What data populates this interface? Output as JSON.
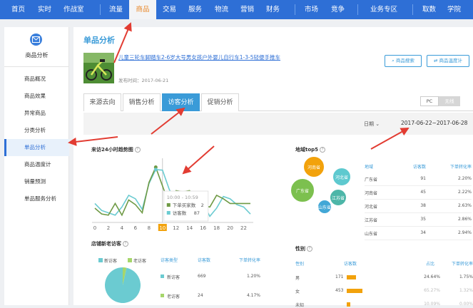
{
  "nav": {
    "items": [
      {
        "label": "首页"
      },
      {
        "label": "实时"
      },
      {
        "label": "作战室"
      },
      {
        "label": "流量"
      },
      {
        "label": "商品"
      },
      {
        "label": "交易"
      },
      {
        "label": "服务"
      },
      {
        "label": "物流"
      },
      {
        "label": "营销"
      },
      {
        "label": "财务"
      },
      {
        "label": "市场"
      },
      {
        "label": "竞争"
      },
      {
        "label": "业务专区"
      },
      {
        "label": "取数"
      },
      {
        "label": "学院"
      }
    ],
    "active_index": 4
  },
  "sidebar": {
    "title": "商品分析",
    "icon": "envelope-icon",
    "items": [
      {
        "label": "商品概况"
      },
      {
        "label": "商品效果"
      },
      {
        "label": "异常商品"
      },
      {
        "label": "分类分析"
      },
      {
        "label": "单品分析"
      },
      {
        "label": "商品温度计"
      },
      {
        "label": "销量预测"
      },
      {
        "label": "单品服务分析"
      }
    ],
    "active_index": 4
  },
  "page": {
    "title": "单品分析",
    "product_name": "儿童三轮车脚踏车2-6岁大号男女孩户外婴儿自行车1-3-5轻便手推车",
    "publish_date": "发布时间：2017-06-21",
    "btn_search": "商品搜索",
    "btn_thermo": "商品温度计"
  },
  "tabs": [
    {
      "label": "来源去向"
    },
    {
      "label": "销售分析"
    },
    {
      "label": "访客分析"
    },
    {
      "label": "促销分析"
    }
  ],
  "active_tab": 2,
  "toggle": {
    "pc": "PC",
    "wireless": "无线"
  },
  "date": {
    "label": "日期",
    "range": "2017-06-22~2017-06-28"
  },
  "panels": {
    "hourly_title": "来访24小时趋势图",
    "tooltip": {
      "time": "10:00 - 10:59",
      "row1_label": "下单买家数",
      "row1_value": "2",
      "row2_label": "访客数",
      "row2_value": "87"
    },
    "geo_title": "地域top5",
    "geo_headers": [
      "地域",
      "访客数",
      "下单转化率"
    ],
    "geo_rows": [
      {
        "region": "广东省",
        "visitors": "91",
        "rate": "2.20%"
      },
      {
        "region": "河南省",
        "visitors": "45",
        "rate": "2.22%"
      },
      {
        "region": "河北省",
        "visitors": "38",
        "rate": "2.63%"
      },
      {
        "region": "江苏省",
        "visitors": "35",
        "rate": "2.86%"
      },
      {
        "region": "山东省",
        "visitors": "34",
        "rate": "2.94%"
      }
    ],
    "bubbles": [
      {
        "label": "河南省",
        "color": "#f2a20c"
      },
      {
        "label": "河北省",
        "color": "#5ec9cf"
      },
      {
        "label": "广东省",
        "color": "#7cc04f"
      },
      {
        "label": "江苏省",
        "color": "#4db6a8"
      },
      {
        "label": "山东省",
        "color": "#42a7d6"
      }
    ],
    "newold_title": "店铺新老访客",
    "newold_legend": {
      "new": "新访客",
      "old": "老访客"
    },
    "newold_headers": [
      "访客类型",
      "访客数",
      "下单转化率"
    ],
    "newold_rows": [
      {
        "type": "新访客",
        "visitors": "669",
        "rate": "1.20%"
      },
      {
        "type": "老访客",
        "visitors": "24",
        "rate": "4.17%"
      }
    ],
    "gender_title": "性别",
    "gender_headers": [
      "性别",
      "访客数",
      "占比",
      "下单转化率"
    ],
    "gender_rows": [
      {
        "gender": "男",
        "visitors": "171",
        "share": "24.64%",
        "rate": "1.75%"
      },
      {
        "gender": "女",
        "visitors": "453",
        "share": "65.27%",
        "rate": "1.32%"
      },
      {
        "gender": "未知",
        "visitors": "",
        "share": "10.09%",
        "rate": "0.00%"
      }
    ]
  },
  "chart_data": [
    {
      "type": "line",
      "x": [
        0,
        1,
        2,
        3,
        4,
        5,
        6,
        7,
        8,
        9,
        10,
        11,
        12,
        13,
        14,
        15,
        16,
        17,
        18,
        19,
        20,
        21,
        22,
        23
      ],
      "x_ticks": [
        "0",
        "2",
        "4",
        "6",
        "8",
        "10",
        "12",
        "14",
        "16",
        "18",
        "20",
        "22"
      ],
      "highlight_x": 10,
      "series": [
        {
          "color": "#6bcbd1",
          "values": [
            30,
            18,
            14,
            10,
            24,
            44,
            38,
            20,
            64,
            88,
            87,
            54,
            32,
            12,
            40,
            26,
            30,
            8,
            22,
            42,
            38,
            28,
            24,
            12
          ]
        },
        {
          "color": "#6f9a45",
          "values": [
            22,
            12,
            10,
            30,
            10,
            36,
            28,
            14,
            66,
            92,
            60,
            28,
            52,
            50,
            52,
            40,
            26,
            24,
            44,
            38,
            30,
            30,
            30,
            30
          ]
        }
      ],
      "ylim": [
        0,
        100
      ]
    },
    {
      "type": "pie",
      "slices": [
        {
          "label": "新访客",
          "value": 669,
          "color": "#6bcbd1"
        },
        {
          "label": "老访客",
          "value": 24,
          "color": "#a6d66b"
        }
      ]
    }
  ]
}
